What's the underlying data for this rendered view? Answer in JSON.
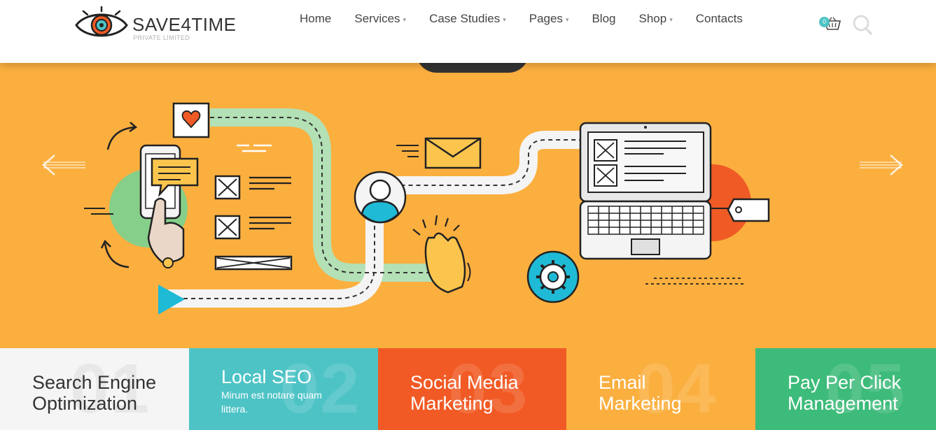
{
  "brand": {
    "name": "SAVE4TIME",
    "tagline": "PRIVATE LIMITED"
  },
  "nav": {
    "items": [
      {
        "label": "Home",
        "has_dropdown": false
      },
      {
        "label": "Services",
        "has_dropdown": true
      },
      {
        "label": "Case Studies",
        "has_dropdown": true
      },
      {
        "label": "Pages",
        "has_dropdown": true
      },
      {
        "label": "Blog",
        "has_dropdown": false
      },
      {
        "label": "Shop",
        "has_dropdown": true
      },
      {
        "label": "Contacts",
        "has_dropdown": false
      }
    ],
    "caret": "▾"
  },
  "cart": {
    "count": "0",
    "icon": "basket-icon"
  },
  "search": {
    "icon": "search-icon"
  },
  "slider": {
    "prev_icon": "arrow-left-icon",
    "next_icon": "arrow-right-icon",
    "illustration": "seo-workflow-illustration"
  },
  "colors": {
    "slide_bg": "#fbaf3f",
    "accent_teal": "#4ec3c6",
    "accent_orange": "#f15a24",
    "accent_green": "#3dbb7a"
  },
  "tiles": [
    {
      "number": "01",
      "title_line1": "Search Engine",
      "title_line2": "Optimization",
      "desc_line1": "",
      "desc_line2": "",
      "bg": "#f5f5f5",
      "text": "#333333"
    },
    {
      "number": "02",
      "title_line1": "Local SEO",
      "title_line2": "",
      "desc_line1": "Mirum est notare quam",
      "desc_line2": "littera.",
      "bg": "#4ec3c6",
      "text": "#ffffff"
    },
    {
      "number": "03",
      "title_line1": "Social Media",
      "title_line2": "Marketing",
      "desc_line1": "",
      "desc_line2": "",
      "bg": "#f15a24",
      "text": "#ffffff"
    },
    {
      "number": "04",
      "title_line1": "Email",
      "title_line2": "Marketing",
      "desc_line1": "",
      "desc_line2": "",
      "bg": "#fbaf3f",
      "text": "#ffffff"
    },
    {
      "number": "05",
      "title_line1": "Pay Per Click",
      "title_line2": "Management",
      "desc_line1": "",
      "desc_line2": "",
      "bg": "#3dbb7a",
      "text": "#ffffff"
    }
  ]
}
